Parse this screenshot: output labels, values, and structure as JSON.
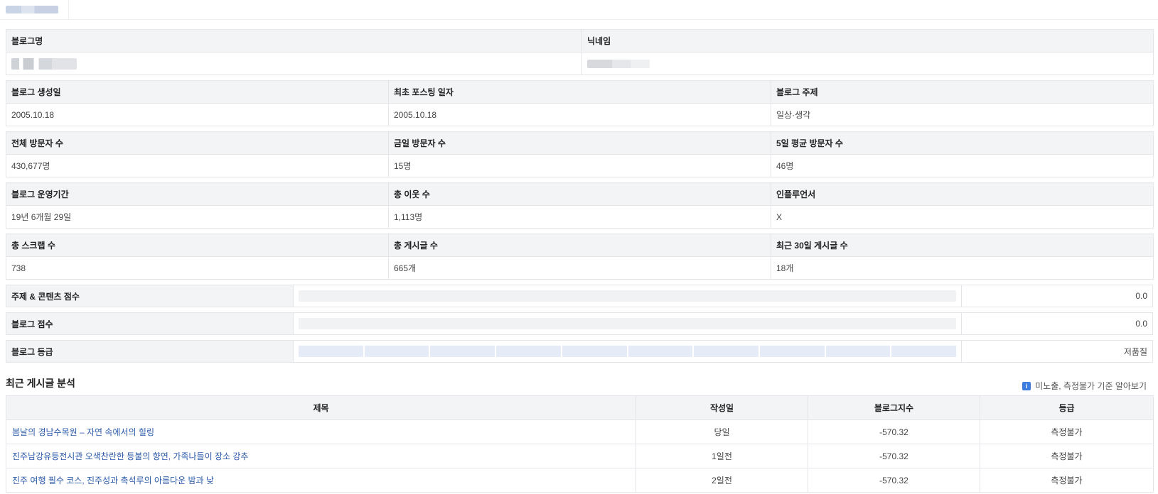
{
  "info": {
    "blog_name_header": "블로그명",
    "nickname_header": "닉네임",
    "rows": [
      [
        {
          "label": "블로그 생성일",
          "value": "2005.10.18"
        },
        {
          "label": "최초 포스팅 일자",
          "value": "2005.10.18"
        },
        {
          "label": "블로그 주제",
          "value": "일상·생각"
        }
      ],
      [
        {
          "label": "전체 방문자 수",
          "value": "430,677명"
        },
        {
          "label": "금일 방문자 수",
          "value": "15명"
        },
        {
          "label": "5일 평균 방문자 수",
          "value": "46명"
        }
      ],
      [
        {
          "label": "블로그 운영기간",
          "value": "19년 6개월 29일"
        },
        {
          "label": "총 이웃 수",
          "value": "1,113명"
        },
        {
          "label": "인플루언서",
          "value": "X"
        }
      ],
      [
        {
          "label": "총 스크랩 수",
          "value": "738"
        },
        {
          "label": "총 게시글 수",
          "value": "665개"
        },
        {
          "label": "최근 30일 게시글 수",
          "value": "18개"
        }
      ]
    ]
  },
  "scores": {
    "content_label": "주제 & 콘텐츠 점수",
    "content_value": "0.0",
    "content_fraction": 0,
    "blog_label": "블로그 점수",
    "blog_value": "0.0",
    "blog_fraction": 0,
    "grade_label": "블로그 등급",
    "grade_value": "저품질",
    "grade_segments": 10
  },
  "analysis": {
    "title": "최근 게시글 분석",
    "info_icon_glyph": "i",
    "info_link": "미노출, 측정불가 기준 알아보기",
    "columns": [
      "제목",
      "작성일",
      "블로그지수",
      "등급"
    ],
    "posts": [
      {
        "title": "봄날의 경남수목원 – 자연 속에서의 힐링",
        "date": "당일",
        "index": "-570.32",
        "grade": "측정불가"
      },
      {
        "title": "진주남강유등전시관 오색찬란한 등불의 향연, 가족나들이 장소 강추",
        "date": "1일전",
        "index": "-570.32",
        "grade": "측정불가"
      },
      {
        "title": "진주 여행 필수 코스, 진주성과 촉석루의 아름다운 밤과 낮",
        "date": "2일전",
        "index": "-570.32",
        "grade": "측정불가"
      }
    ]
  },
  "colors": {
    "header_bg": "#f3f4f6",
    "border": "#e3e5e8",
    "link": "#2b5aa8",
    "info_icon": "#3b7ddd",
    "grade_segment": "#e6ecf7"
  }
}
